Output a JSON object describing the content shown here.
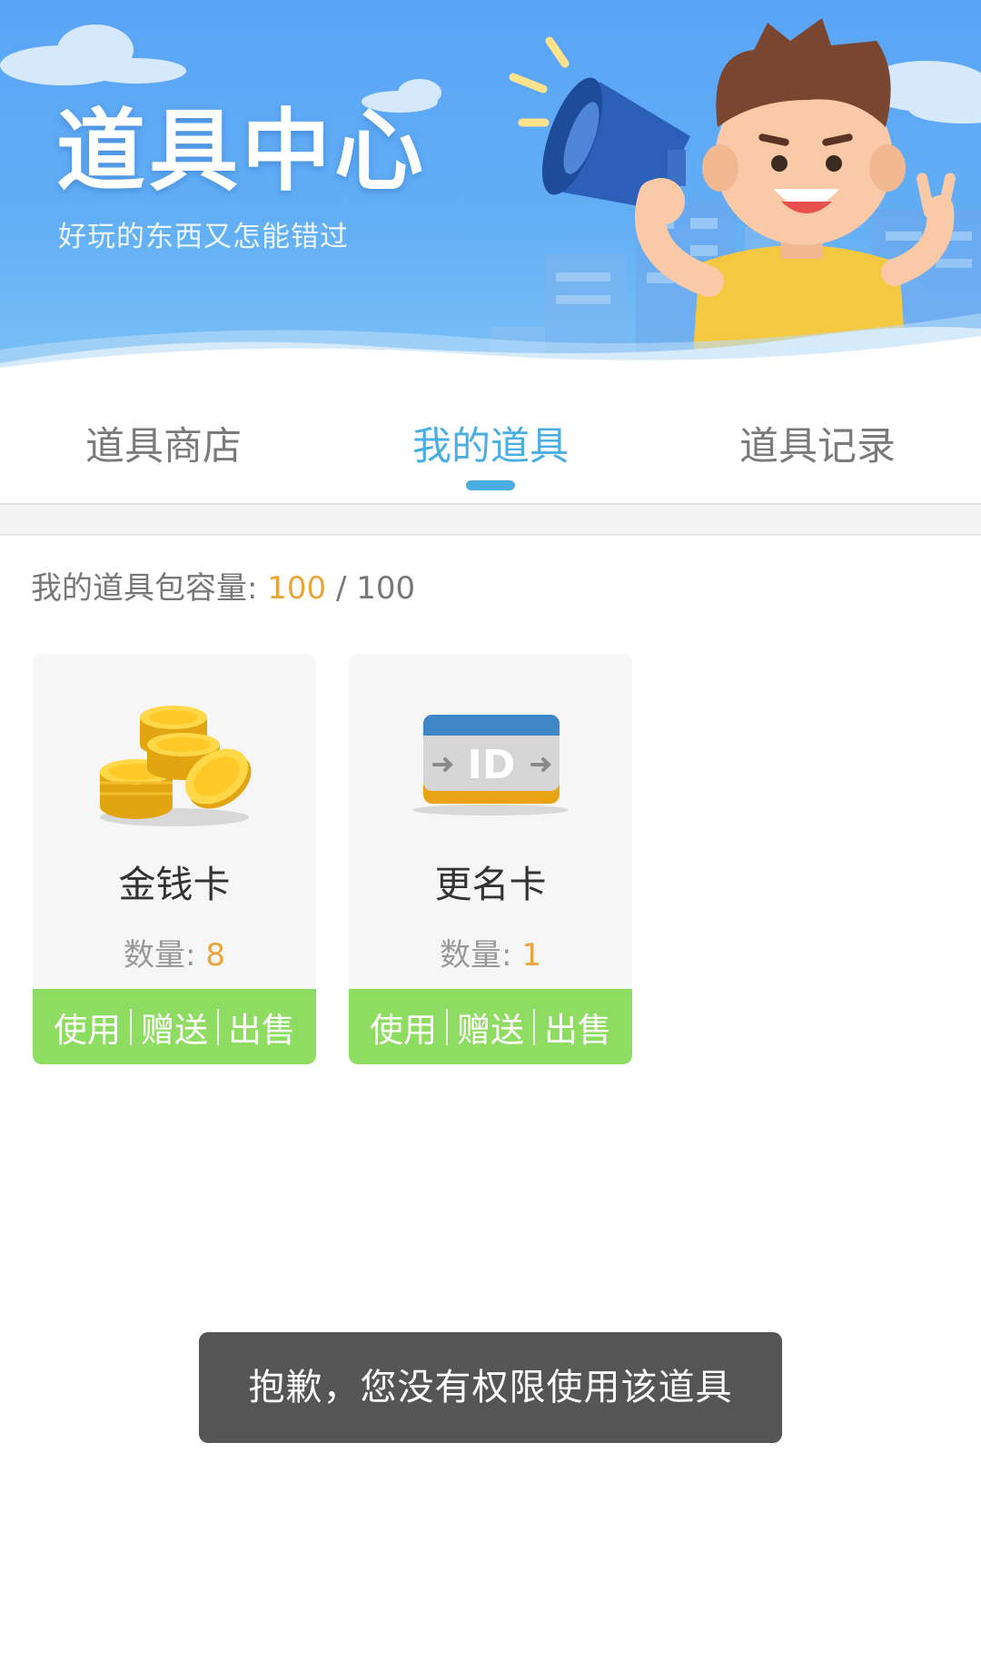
{
  "banner": {
    "title": "道具中心",
    "subtitle": "好玩的东西又怎能错过"
  },
  "tabs": [
    {
      "label": "道具商店",
      "active": false
    },
    {
      "label": "我的道具",
      "active": true
    },
    {
      "label": "道具记录",
      "active": false
    }
  ],
  "capacity": {
    "label": "我的道具包容量: ",
    "used": "100",
    "separator": " / ",
    "total": "100"
  },
  "items": [
    {
      "name": "金钱卡",
      "icon": "gold-coins-icon",
      "quantity_label": "数量: ",
      "quantity": "8",
      "actions": {
        "use": "使用",
        "gift": "赠送",
        "sell": "出售"
      }
    },
    {
      "name": "更名卡",
      "icon": "id-card-icon",
      "icon_text": "ID",
      "quantity_label": "数量: ",
      "quantity": "1",
      "actions": {
        "use": "使用",
        "gift": "赠送",
        "sell": "出售"
      }
    }
  ],
  "toast": {
    "message": "抱歉，您没有权限使用该道具"
  },
  "colors": {
    "accent": "#4aaee3",
    "highlight": "#e8a53a",
    "action_bar": "#8fdc62",
    "toast_bg": "#555555"
  }
}
